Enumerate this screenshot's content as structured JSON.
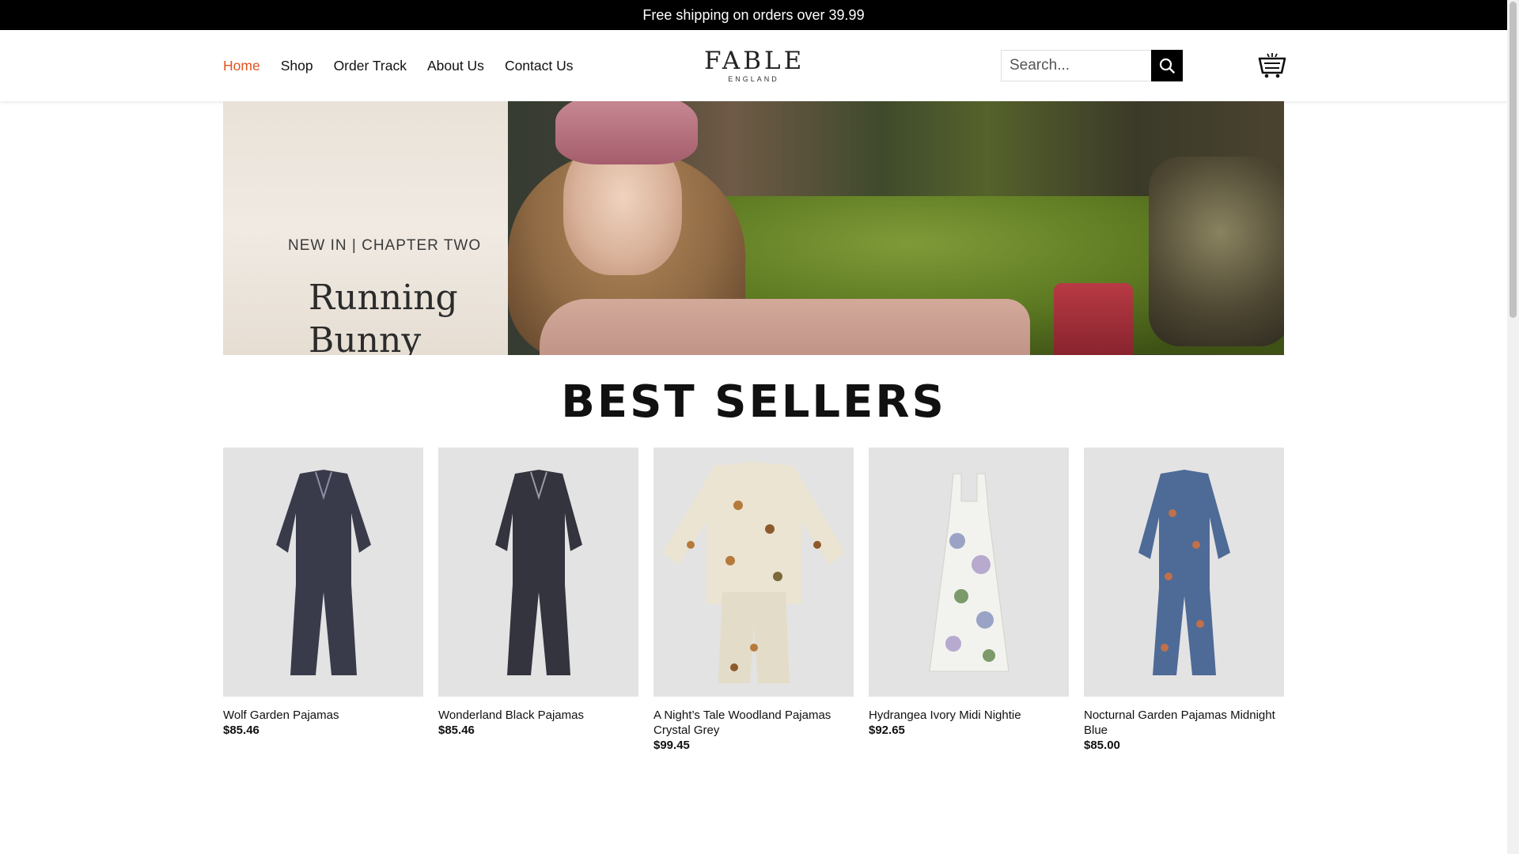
{
  "topbar": {
    "text": "Free shipping on orders over 39.99"
  },
  "nav": {
    "items": [
      {
        "label": "Home",
        "active": true
      },
      {
        "label": "Shop"
      },
      {
        "label": "Order Track"
      },
      {
        "label": "About Us"
      },
      {
        "label": "Contact Us"
      }
    ]
  },
  "logo": {
    "line1": "FABLE",
    "line2": "ENGLAND"
  },
  "search": {
    "placeholder": "Search..."
  },
  "hero": {
    "kicker": "NEW IN | CHAPTER TWO",
    "headline": "Running Bunny"
  },
  "best_sellers": {
    "title": "BEST SELLERS"
  },
  "products": [
    {
      "name": "Wolf Garden Pajamas",
      "price": "$85.46",
      "color": "#3a3b4a"
    },
    {
      "name": "Wonderland Black Pajamas",
      "price": "$85.46",
      "color": "#33343d"
    },
    {
      "name": "A Night’s Tale Woodland Pajamas Crystal Grey",
      "price": "$99.45",
      "color": "#e9e2cf"
    },
    {
      "name": "Hydrangea Ivory Midi Nightie",
      "price": "$92.65",
      "color": "#eef0ea"
    },
    {
      "name": "Nocturnal Garden Pajamas Midnight Blue",
      "price": "$85.00",
      "color": "#4e6a97"
    }
  ],
  "colors": {
    "accent": "#e0531f",
    "topbar_bg": "#000000"
  }
}
